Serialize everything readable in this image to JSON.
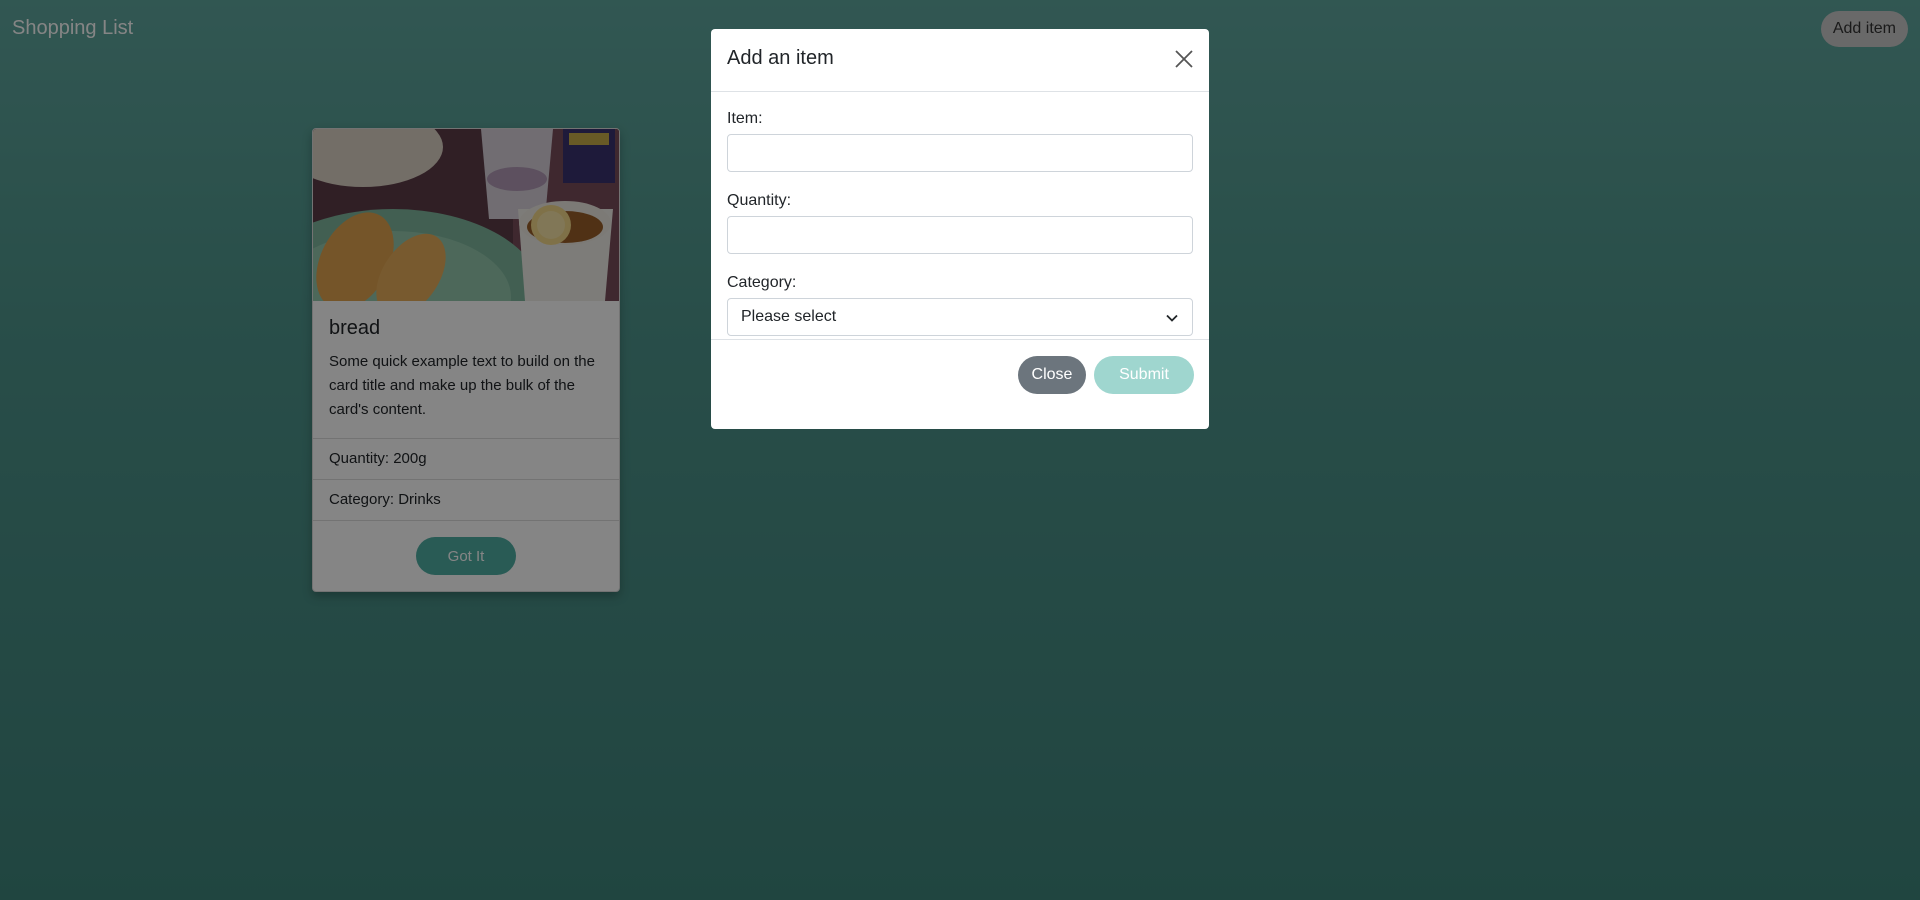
{
  "navbar": {
    "brand": "Shopping List",
    "add_item_label": "Add item"
  },
  "card": {
    "image_alt": "bread",
    "title": "bread",
    "text": "Some quick example text to build on the card title and make up the bulk of the card's content.",
    "quantity": "Quantity: 200g",
    "category": "Category: Drinks",
    "button_label": "Got It"
  },
  "modal": {
    "title": "Add an item",
    "close_icon": "close-icon",
    "item_label": "Item:",
    "item_value": "",
    "quantity_label": "Quantity:",
    "quantity_value": "",
    "category_label": "Category:",
    "category_selected": "Please select",
    "close_button": "Close",
    "submit_button": "Submit"
  },
  "colors": {
    "background_top": "#5fa79e",
    "background_bottom": "#3f857c",
    "accent": "#4faea4",
    "submit_disabled": "#9fd6cf",
    "close_button": "#6c757d"
  }
}
